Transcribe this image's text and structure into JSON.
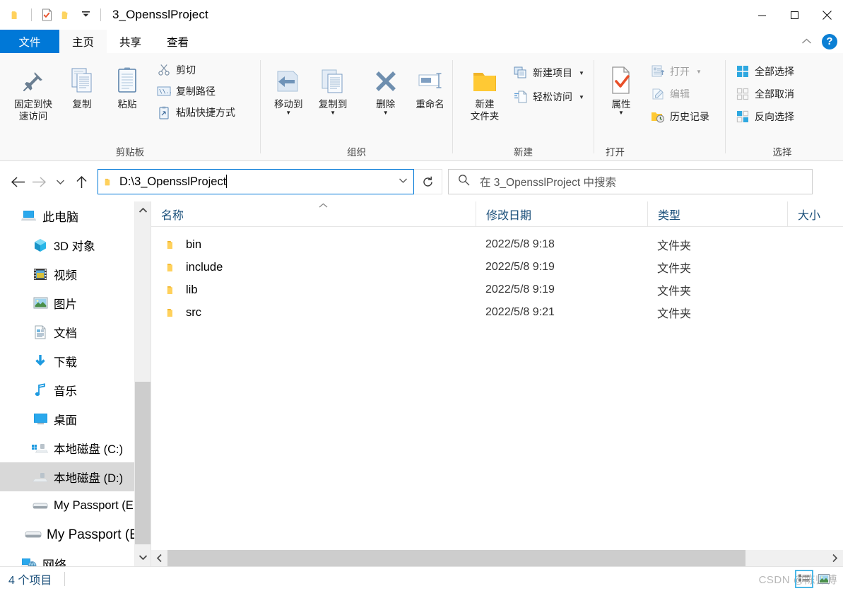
{
  "window": {
    "title": "3_OpensslProject",
    "quick_access": [
      {
        "name": "folder-icon",
        "label": "文件夹"
      },
      {
        "name": "properties-icon",
        "label": "属性"
      },
      {
        "name": "new-folder-icon",
        "label": "新建文件夹"
      },
      {
        "name": "customize-qat-caret",
        "label": "自定义快速访问工具栏"
      }
    ],
    "controls": {
      "minimize": "最小化",
      "maximize": "最大化",
      "close": "关闭"
    }
  },
  "tabs": [
    {
      "id": "file",
      "label": "文件",
      "active": false
    },
    {
      "id": "home",
      "label": "主页",
      "active": true
    },
    {
      "id": "share",
      "label": "共享",
      "active": false
    },
    {
      "id": "view",
      "label": "查看",
      "active": false
    }
  ],
  "ribbon_controls": {
    "collapse": "展开/折叠功能区",
    "help": "?"
  },
  "ribbon": {
    "groups": [
      {
        "id": "clipboard",
        "label": "剪贴板",
        "big": [
          {
            "icon": "pin-icon",
            "label": "固定到快\n速访问",
            "label_line1": "固定到快",
            "label_line2": "速访问"
          },
          {
            "icon": "copy-icon",
            "label": "复制"
          },
          {
            "icon": "paste-icon",
            "label": "粘贴"
          }
        ],
        "small": [
          {
            "icon": "scissors-icon",
            "label": "剪切"
          },
          {
            "icon": "copy-path-icon",
            "label": "复制路径"
          },
          {
            "icon": "paste-shortcut-icon",
            "label": "粘贴快捷方式"
          }
        ]
      },
      {
        "id": "organize",
        "label": "组织",
        "big": [
          {
            "icon": "move-to-icon",
            "label": "移动到",
            "dropdown": true
          },
          {
            "icon": "copy-to-icon",
            "label": "复制到",
            "dropdown": true
          },
          {
            "icon": "delete-icon",
            "label": "删除",
            "dropdown": true
          },
          {
            "icon": "rename-icon",
            "label": "重命名"
          }
        ]
      },
      {
        "id": "new",
        "label": "新建",
        "big": [
          {
            "icon": "new-folder-icon",
            "label_line1": "新建",
            "label_line2": "文件夹"
          }
        ],
        "small": [
          {
            "icon": "new-item-icon",
            "label": "新建项目",
            "dropdown": true
          },
          {
            "icon": "easy-access-icon",
            "label": "轻松访问",
            "dropdown": true
          }
        ]
      },
      {
        "id": "open",
        "label": "打开",
        "big": [
          {
            "icon": "properties-icon",
            "label": "属性",
            "dropdown": true
          }
        ],
        "small": [
          {
            "icon": "open-icon",
            "label": "打开",
            "dropdown": true,
            "disabled": true
          },
          {
            "icon": "edit-icon",
            "label": "编辑",
            "disabled": true
          },
          {
            "icon": "history-icon",
            "label": "历史记录"
          }
        ]
      },
      {
        "id": "select",
        "label": "选择",
        "small": [
          {
            "icon": "select-all-icon",
            "label": "全部选择"
          },
          {
            "icon": "select-none-icon",
            "label": "全部取消"
          },
          {
            "icon": "invert-selection-icon",
            "label": "反向选择"
          }
        ]
      }
    ]
  },
  "navbar": {
    "back": "后退",
    "forward": "前进",
    "recent": "最近浏览的位置",
    "up": "上移一级",
    "address_value": "D:\\3_OpensslProject",
    "address_chevron": "⌄",
    "refresh": "刷新",
    "search_placeholder": "在 3_OpensslProject 中搜索"
  },
  "sidebar": {
    "items": [
      {
        "icon": "this-pc-icon",
        "label": "此电脑",
        "level": 0,
        "selected": false
      },
      {
        "icon": "3d-objects-icon",
        "label": "3D 对象",
        "level": 1,
        "selected": false
      },
      {
        "icon": "videos-icon",
        "label": "视频",
        "level": 1,
        "selected": false
      },
      {
        "icon": "pictures-icon",
        "label": "图片",
        "level": 1,
        "selected": false
      },
      {
        "icon": "documents-icon",
        "label": "文档",
        "level": 1,
        "selected": false
      },
      {
        "icon": "downloads-icon",
        "label": "下载",
        "level": 1,
        "selected": false
      },
      {
        "icon": "music-icon",
        "label": "音乐",
        "level": 1,
        "selected": false
      },
      {
        "icon": "desktop-icon",
        "label": "桌面",
        "level": 1,
        "selected": false
      },
      {
        "icon": "local-disk-c-icon",
        "label": "本地磁盘 (C:)",
        "level": 1,
        "selected": false
      },
      {
        "icon": "local-disk-d-icon",
        "label": "本地磁盘 (D:)",
        "level": 1,
        "selected": true
      },
      {
        "icon": "removable-drive-icon",
        "label": "My Passport (E:)",
        "level": 1,
        "selected": false
      },
      {
        "icon": "removable-drive-icon",
        "label": "My Passport (E:)",
        "level": 0,
        "selected": false,
        "big": true
      },
      {
        "icon": "network-icon",
        "label": "网络",
        "level": 0,
        "selected": false
      }
    ],
    "scroll_up": "向上滚动",
    "scroll_down": "向下滚动"
  },
  "filelist": {
    "sort_indicator": "⌃",
    "columns": [
      {
        "id": "name",
        "label": "名称"
      },
      {
        "id": "date",
        "label": "修改日期"
      },
      {
        "id": "type",
        "label": "类型"
      },
      {
        "id": "size",
        "label": "大小"
      }
    ],
    "rows": [
      {
        "icon": "folder-icon",
        "name": "bin",
        "date": "2022/5/8 9:18",
        "type": "文件夹",
        "size": ""
      },
      {
        "icon": "folder-icon",
        "name": "include",
        "date": "2022/5/8 9:19",
        "type": "文件夹",
        "size": ""
      },
      {
        "icon": "folder-icon",
        "name": "lib",
        "date": "2022/5/8 9:19",
        "type": "文件夹",
        "size": ""
      },
      {
        "icon": "folder-icon",
        "name": "src",
        "date": "2022/5/8 9:21",
        "type": "文件夹",
        "size": ""
      }
    ],
    "scroll_left": "‹",
    "scroll_right": "›"
  },
  "statusbar": {
    "item_count": "4 个项目",
    "watermark": "CSDN @陈师傅",
    "view_details": "详细信息",
    "view_large_icons": "大图标"
  },
  "colors": {
    "accent": "#0078d7",
    "folder_yellow": "#ffc934",
    "selection_gray": "#d8d8d8",
    "ribbon_bg": "#f9f9f9",
    "link_blue": "#1a4f7a",
    "help_blue": "#0b7fd4"
  }
}
